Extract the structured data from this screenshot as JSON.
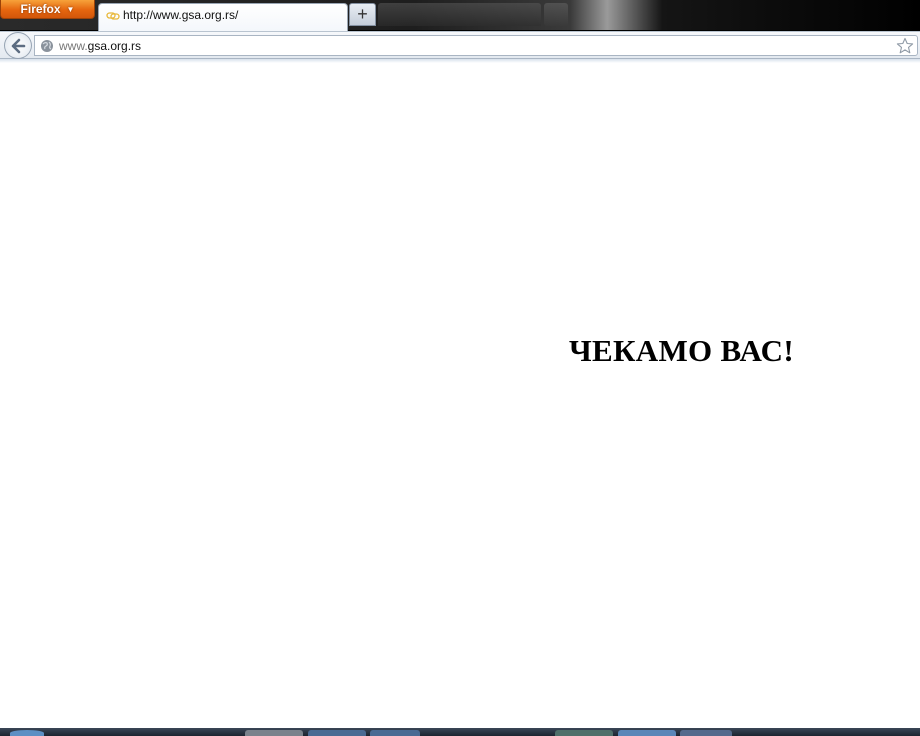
{
  "browser": {
    "menu_button_label": "Firefox",
    "tab_title": "http://www.gsa.org.rs/",
    "new_tab_label": "+",
    "url_prefix": "www.",
    "url_domain": "gsa.org.rs",
    "accent_color": "#e5660f"
  },
  "icons": {
    "back": "back-arrow-icon",
    "site": "globe-icon",
    "bookmark": "star-icon",
    "tab_favicon": "loading-favicon-icon"
  },
  "page": {
    "headline": "ЧЕКАМО ВАС!"
  }
}
